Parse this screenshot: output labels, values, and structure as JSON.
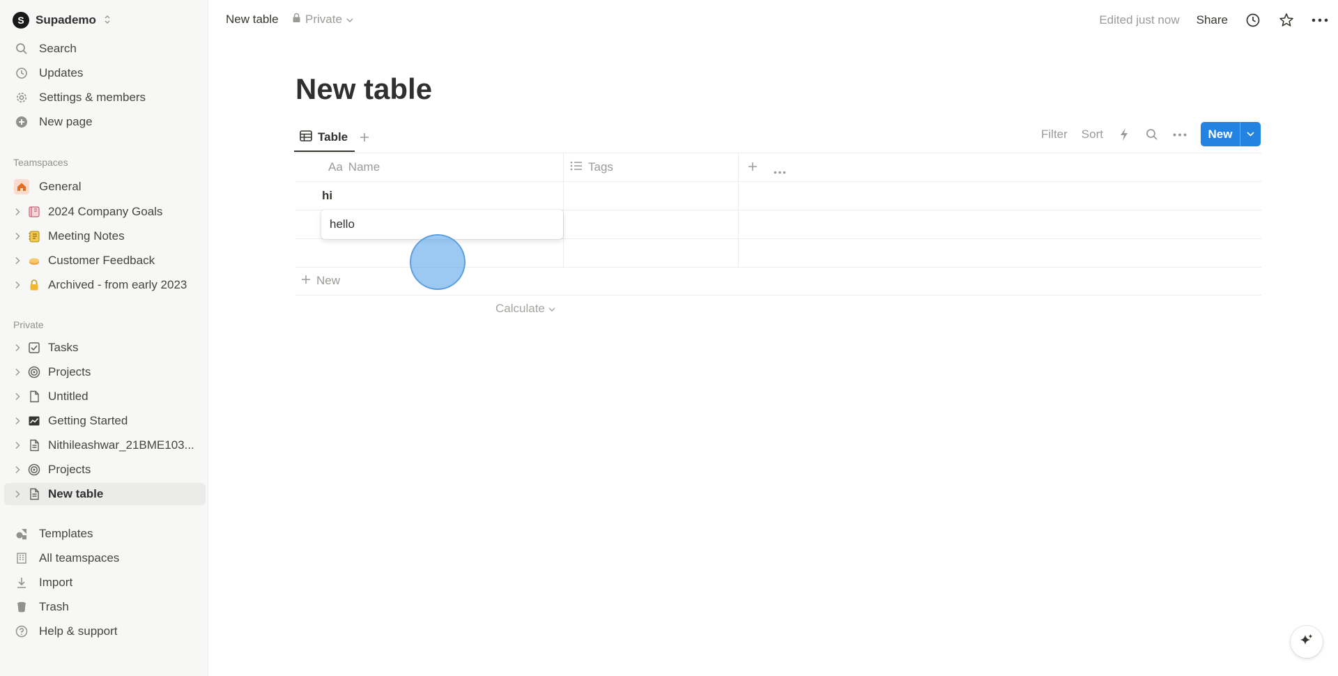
{
  "workspace": {
    "initial": "S",
    "name": "Supademo"
  },
  "nav": [
    {
      "label": "Search",
      "icon": "search-icon"
    },
    {
      "label": "Updates",
      "icon": "clock-icon"
    },
    {
      "label": "Settings & members",
      "icon": "gear-icon"
    },
    {
      "label": "New page",
      "icon": "plus-circle-icon"
    }
  ],
  "teamspaces": {
    "label": "Teamspaces",
    "items": [
      {
        "label": "General",
        "icon": "home-icon"
      },
      {
        "label": "2024 Company Goals",
        "icon": "notebook-icon"
      },
      {
        "label": "Meeting Notes",
        "icon": "notepad-icon"
      },
      {
        "label": "Customer Feedback",
        "icon": "pie-icon"
      },
      {
        "label": "Archived - from early 2023",
        "icon": "lock-icon"
      }
    ]
  },
  "private": {
    "label": "Private",
    "items": [
      {
        "label": "Tasks",
        "icon": "checkbox-icon"
      },
      {
        "label": "Projects",
        "icon": "target-icon"
      },
      {
        "label": "Untitled",
        "icon": "page-icon"
      },
      {
        "label": "Getting Started",
        "icon": "chart-icon"
      },
      {
        "label": "Nithileashwar_21BME103...",
        "icon": "page-icon"
      },
      {
        "label": "Projects",
        "icon": "target-icon"
      },
      {
        "label": "New table",
        "icon": "page-icon",
        "active": true
      }
    ]
  },
  "footer_nav": [
    {
      "label": "Templates",
      "icon": "shapes-icon"
    },
    {
      "label": "All teamspaces",
      "icon": "building-icon"
    },
    {
      "label": "Import",
      "icon": "download-icon"
    },
    {
      "label": "Trash",
      "icon": "trash-icon"
    },
    {
      "label": "Help & support",
      "icon": "help-icon"
    }
  ],
  "topbar": {
    "title": "New table",
    "privacy": "Private",
    "edited": "Edited just now",
    "share": "Share"
  },
  "page": {
    "title": "New table",
    "view_tab": "Table",
    "tools": {
      "filter": "Filter",
      "sort": "Sort"
    },
    "new_button": "New"
  },
  "table": {
    "columns": [
      {
        "prefix": "Aa",
        "label": "Name"
      },
      {
        "label": "Tags"
      }
    ],
    "rows": [
      {
        "name": "hi",
        "tags": ""
      },
      {
        "name": "",
        "tags": ""
      },
      {
        "name": "",
        "tags": ""
      }
    ],
    "add_row": "New",
    "calculate": "Calculate",
    "editing_value": "hello"
  },
  "colors": {
    "accent": "#2383e2",
    "sidebar_bg": "#f7f7f5",
    "click_indicator": "#60a8e9"
  }
}
